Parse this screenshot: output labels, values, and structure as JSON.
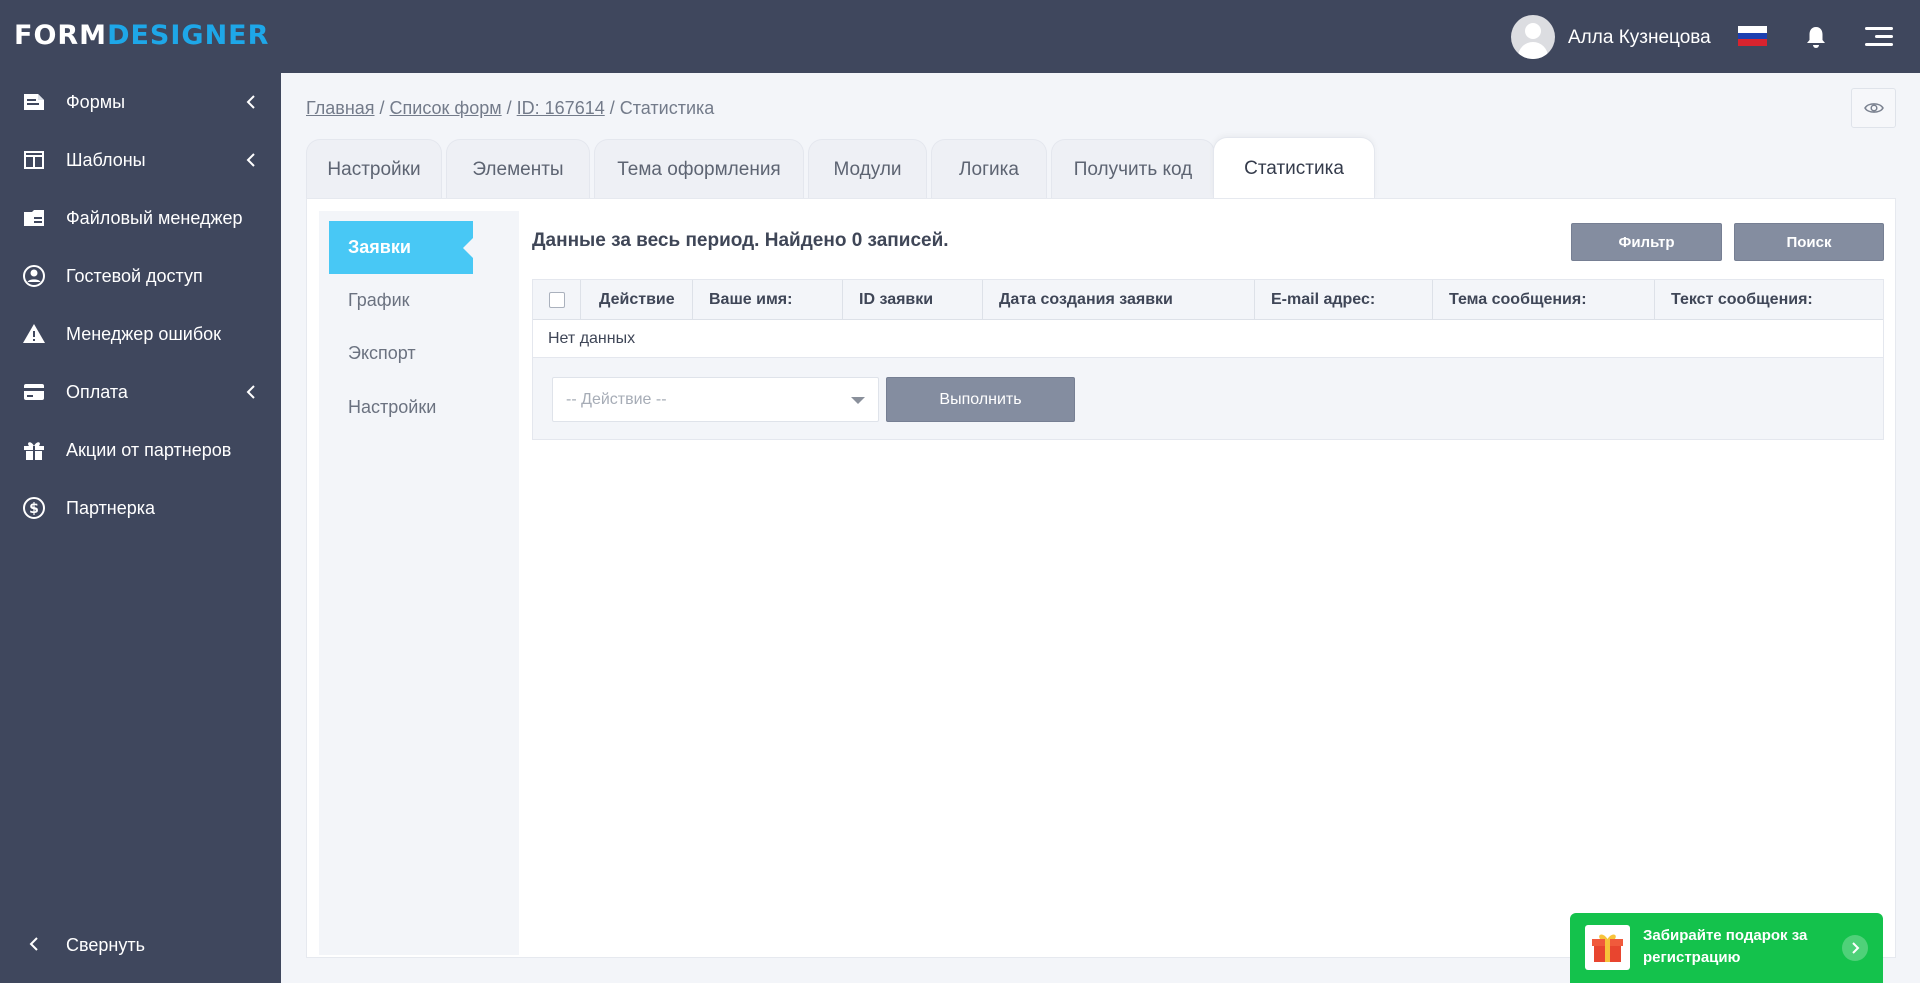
{
  "header": {
    "logo_part1": "FORM",
    "logo_part2": "DESIGNER",
    "user_name": "Алла Кузнецова"
  },
  "sidebar": {
    "items": [
      {
        "label": "Формы",
        "icon": "forms-icon",
        "has_submenu": true
      },
      {
        "label": "Шаблоны",
        "icon": "templates-icon",
        "has_submenu": true
      },
      {
        "label": "Файловый менеджер",
        "icon": "file-manager-icon",
        "has_submenu": false
      },
      {
        "label": "Гостевой доступ",
        "icon": "user-circle-icon",
        "has_submenu": false
      },
      {
        "label": "Менеджер ошибок",
        "icon": "warning-icon",
        "has_submenu": false
      },
      {
        "label": "Оплата",
        "icon": "credit-card-icon",
        "has_submenu": true
      },
      {
        "label": "Акции от партнеров",
        "icon": "gift-icon",
        "has_submenu": false
      },
      {
        "label": "Партнерка",
        "icon": "dollar-circle-icon",
        "has_submenu": false
      }
    ],
    "collapse_label": "Свернуть"
  },
  "breadcrumb": {
    "home": "Главная",
    "sep1": " / ",
    "forms_list": "Список форм",
    "sep2": " / ",
    "form_id": "ID: 167614",
    "sep3": " / ",
    "current": "Статистика"
  },
  "tabs": [
    {
      "label": "Настройки",
      "active": false
    },
    {
      "label": "Элементы",
      "active": false
    },
    {
      "label": "Тема оформления",
      "active": false
    },
    {
      "label": "Модули",
      "active": false
    },
    {
      "label": "Логика",
      "active": false
    },
    {
      "label": "Получить код",
      "active": false
    },
    {
      "label": "Статистика",
      "active": true
    }
  ],
  "subnav": [
    {
      "label": "Заявки",
      "active": true
    },
    {
      "label": "График",
      "active": false
    },
    {
      "label": "Экспорт",
      "active": false
    },
    {
      "label": "Настройки",
      "active": false
    }
  ],
  "stats": {
    "summary": "Данные за весь период. Найдено 0 записей.",
    "filter_label": "Фильтр",
    "search_label": "Поиск",
    "columns": [
      "Действие",
      "Ваше имя:",
      "ID заявки",
      "Дата создания заявки",
      "E-mail адрес:",
      "Тема сообщения:",
      "Текст сообщения:"
    ],
    "empty_text": "Нет данных",
    "action_placeholder": "-- Действие --",
    "execute_label": "Выполнить"
  },
  "promo": {
    "text": "Забирайте подарок за регистрацию"
  },
  "colors": {
    "topbar": "#3f475d",
    "accent": "#48c8f5",
    "logo_accent": "#1ea7e8",
    "button": "#848da0",
    "promo": "#14c24c"
  }
}
